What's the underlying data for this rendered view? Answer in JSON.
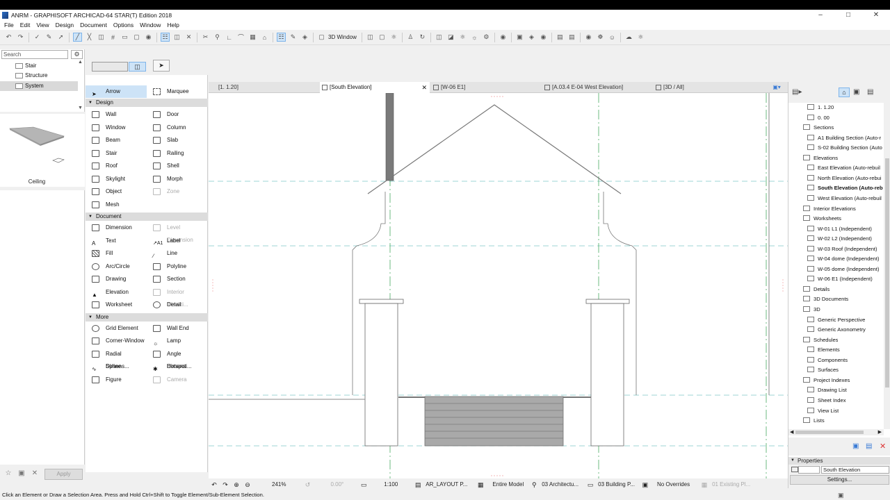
{
  "window": {
    "title": "ANRM - GRAPHISOFT ARCHICAD-64 STAR(T) Edition 2018",
    "minimize": "–",
    "maximize": "□",
    "close": "✕"
  },
  "menu": [
    "File",
    "Edit",
    "View",
    "Design",
    "Document",
    "Options",
    "Window",
    "Help"
  ],
  "toolbar": {
    "window3d_label": "3D Window"
  },
  "navigator_left": {
    "search_placeholder": "Search",
    "items": [
      "Stair",
      "Structure",
      "System"
    ],
    "selected": "System",
    "preview_label": "Ceiling"
  },
  "toolbox": {
    "arrow": "Arrow",
    "marquee": "Marquee",
    "design_header": "Design",
    "design": [
      "Wall",
      "Door",
      "Window",
      "Column",
      "Beam",
      "Slab",
      "Stair",
      "Railing",
      "Roof",
      "Shell",
      "Skylight",
      "Morph",
      "Object",
      "Zone",
      "Mesh"
    ],
    "document_header": "Document",
    "document": [
      "Dimension",
      "Level Dimension",
      "Text",
      "Label",
      "Fill",
      "Line",
      "Arc/Circle",
      "Polyline",
      "Drawing",
      "Section",
      "Elevation",
      "Interior Elevati...",
      "Worksheet",
      "Detail"
    ],
    "more_header": "More",
    "more": [
      "Grid Element",
      "Wall End",
      "Corner-Window",
      "Lamp",
      "Radial Dimens...",
      "Angle Dimensi...",
      "Spline",
      "Hotspot",
      "Figure",
      "Camera"
    ],
    "apply": "Apply"
  },
  "tabs": [
    {
      "label": "[1. 1.20]"
    },
    {
      "label": "[South Elevation]",
      "active": true,
      "close": "✕"
    },
    {
      "label": "[W-06 E1]"
    },
    {
      "label": "[A.03.4 E-04 West Elevation]"
    },
    {
      "label": "[3D / All]"
    }
  ],
  "view_status": {
    "zoom": "241%",
    "angle": "0.00°",
    "scale": "1:100",
    "layer": "AR_LAYOUT P...",
    "model": "Entire Model",
    "pen": "03 Architectu...",
    "mvo": "03 Building P...",
    "override": "No Overrides",
    "renovation": "01 Existing Pl..."
  },
  "navigator_right": {
    "tree": [
      {
        "label": "1. 1.20",
        "level": 2
      },
      {
        "label": "0. 00",
        "level": 2
      },
      {
        "label": "Sections",
        "level": 1,
        "expanded": true
      },
      {
        "label": "A1 Building Section (Auto-r",
        "level": 2
      },
      {
        "label": "S-02 Building Section (Auto",
        "level": 2
      },
      {
        "label": "Elevations",
        "level": 1,
        "expanded": true
      },
      {
        "label": "East Elevation (Auto-rebuil",
        "level": 2
      },
      {
        "label": "North Elevation (Auto-rebui",
        "level": 2
      },
      {
        "label": "South Elevation (Auto-rebu",
        "level": 2,
        "bold": true
      },
      {
        "label": "West Elevation (Auto-rebuil",
        "level": 2
      },
      {
        "label": "Interior Elevations",
        "level": 1
      },
      {
        "label": "Worksheets",
        "level": 1,
        "expanded": true
      },
      {
        "label": "W-01 L1 (Independent)",
        "level": 2
      },
      {
        "label": "W-02 L2 (Independent)",
        "level": 2
      },
      {
        "label": "W-03 Roof (Independent)",
        "level": 2
      },
      {
        "label": "W-04 dome (Independent)",
        "level": 2
      },
      {
        "label": "W-05 dome (Independent)",
        "level": 2
      },
      {
        "label": "W-06 E1 (Independent)",
        "level": 2
      },
      {
        "label": "Details",
        "level": 1
      },
      {
        "label": "3D Documents",
        "level": 1
      },
      {
        "label": "3D",
        "level": 1,
        "expanded": true
      },
      {
        "label": "Generic Perspective",
        "level": 2
      },
      {
        "label": "Generic Axonometry",
        "level": 2
      },
      {
        "label": "Schedules",
        "level": 1,
        "expanded": true
      },
      {
        "label": "Elements",
        "level": 2,
        "collapsed": true
      },
      {
        "label": "Components",
        "level": 2,
        "collapsed": true
      },
      {
        "label": "Surfaces",
        "level": 2,
        "collapsed": true
      },
      {
        "label": "Project Indexes",
        "level": 1,
        "expanded": true
      },
      {
        "label": "Drawing List",
        "level": 2
      },
      {
        "label": "Sheet Index",
        "level": 2
      },
      {
        "label": "View List",
        "level": 2
      },
      {
        "label": "Lists",
        "level": 1,
        "expanded": true
      }
    ]
  },
  "properties": {
    "header": "Properties",
    "name_value": "South Elevation",
    "settings": "Settings..."
  },
  "statusbar": {
    "message": "Click an Element or Draw a Selection Area. Press and Hold Ctrl+Shift to Toggle Element/Sub-Element Selection."
  }
}
